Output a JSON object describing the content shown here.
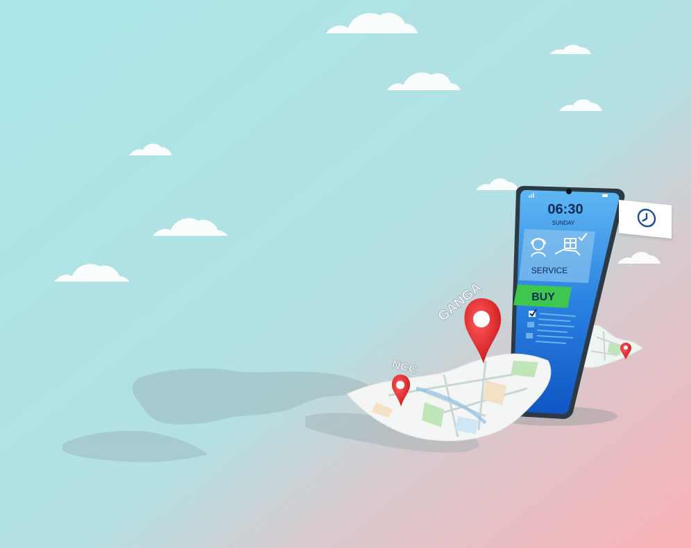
{
  "phone": {
    "time": "06:30",
    "day": "SUNDAY",
    "service_label": "SERVICE",
    "buy_label": "BUY"
  },
  "labels": {
    "ganga": "GANGA",
    "ncc": "NCC"
  },
  "colors": {
    "sky_top": "#abe6e8",
    "floor_pink": "#f6b6bd",
    "screen_blue": "#1d73d6",
    "buy_green": "#38c24c",
    "pin_red": "#e8272b"
  },
  "icons": {
    "clock": "clock-icon",
    "support": "headset-support-icon",
    "delivery": "box-delivery-icon",
    "checklist": "checklist-icon"
  }
}
